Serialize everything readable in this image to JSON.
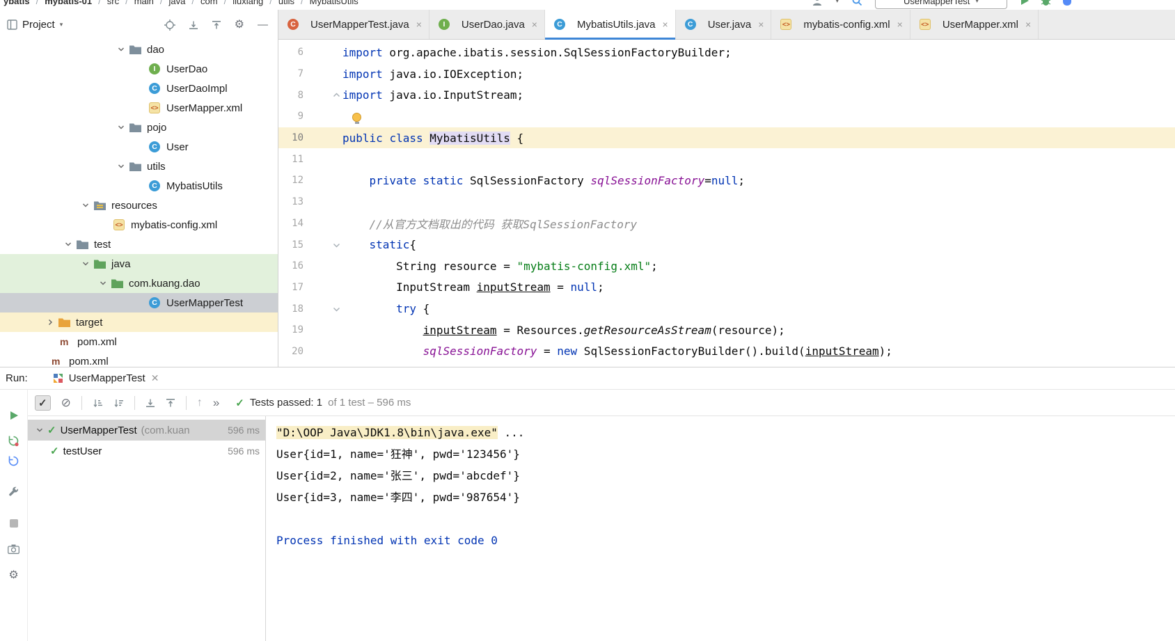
{
  "topbar": {
    "breadcrumbs": [
      "ybatis",
      "mybatis-01",
      "src",
      "main",
      "java",
      "com",
      "liuxiang",
      "utils",
      "MybatisUtils"
    ],
    "run_config": "UserMapperTest",
    "right_icons": [
      "run-icon",
      "debug-icon",
      "coverage-icon"
    ]
  },
  "project": {
    "title": "Project",
    "header_icons": [
      "locate-icon",
      "expand-all-icon",
      "collapse-all-icon",
      "settings-icon",
      "hide-icon"
    ],
    "tree": [
      {
        "label": "dao",
        "icon": "folder",
        "chevron": "down",
        "indent": 162
      },
      {
        "label": "UserDao",
        "icon": "interface",
        "indent": 214
      },
      {
        "label": "UserDaoImpl",
        "icon": "class",
        "indent": 214
      },
      {
        "label": "UserMapper.xml",
        "icon": "xml",
        "indent": 214
      },
      {
        "label": "pojo",
        "icon": "folder",
        "chevron": "down",
        "indent": 162
      },
      {
        "label": "User",
        "icon": "class",
        "indent": 214
      },
      {
        "label": "utils",
        "icon": "folder",
        "chevron": "down",
        "indent": 162
      },
      {
        "label": "MybatisUtils",
        "icon": "class",
        "indent": 214
      },
      {
        "label": "resources",
        "icon": "resources-folder",
        "chevron": "down",
        "indent": 111
      },
      {
        "label": "mybatis-config.xml",
        "icon": "xml",
        "indent": 163
      },
      {
        "label": "test",
        "icon": "folder",
        "chevron": "down",
        "indent": 86
      },
      {
        "label": "java",
        "icon": "test-folder",
        "chevron": "down",
        "indent": 111,
        "highlight": "green"
      },
      {
        "label": "com.kuang.dao",
        "icon": "test-folder",
        "chevron": "down",
        "indent": 136,
        "highlight": "green"
      },
      {
        "label": "UserMapperTest",
        "icon": "class",
        "indent": 214,
        "highlight": "sel"
      },
      {
        "label": "target",
        "icon": "excluded-folder",
        "chevron": "right",
        "indent": 60,
        "highlight": "yellow"
      },
      {
        "label": "pom.xml",
        "icon": "maven",
        "indent": 86
      },
      {
        "label": "pom.xml",
        "icon": "maven",
        "indent": 74
      }
    ]
  },
  "editor": {
    "tabs": [
      {
        "label": "UserMapperTest.java",
        "icon": "class-test"
      },
      {
        "label": "UserDao.java",
        "icon": "interface"
      },
      {
        "label": "MybatisUtils.java",
        "icon": "class",
        "active": true
      },
      {
        "label": "User.java",
        "icon": "class"
      },
      {
        "label": "mybatis-config.xml",
        "icon": "xml"
      },
      {
        "label": "UserMapper.xml",
        "icon": "xml"
      }
    ],
    "lines": [
      {
        "num": "6",
        "tokens": [
          [
            "kw",
            "import"
          ],
          [
            "pl",
            " org.apache.ibatis.session.SqlSessionFactoryBuilder;"
          ]
        ]
      },
      {
        "num": "7",
        "tokens": [
          [
            "kw",
            "import"
          ],
          [
            "pl",
            " java.io.IOException;"
          ]
        ]
      },
      {
        "num": "8",
        "fold": "up",
        "tokens": [
          [
            "kw",
            "import"
          ],
          [
            "pl",
            " java.io.InputStream;"
          ]
        ]
      },
      {
        "num": "9",
        "bulb": true,
        "tokens": []
      },
      {
        "num": "10",
        "current": true,
        "tokens": [
          [
            "kw",
            "public"
          ],
          [
            "pl",
            " "
          ],
          [
            "kw",
            "class"
          ],
          [
            "pl",
            " "
          ],
          [
            "hl",
            "MybatisUtils"
          ],
          [
            "pl",
            " {"
          ]
        ]
      },
      {
        "num": "11",
        "tokens": []
      },
      {
        "num": "12",
        "tokens": [
          [
            "pl",
            "    "
          ],
          [
            "kw",
            "private"
          ],
          [
            "pl",
            " "
          ],
          [
            "kw",
            "static"
          ],
          [
            "pl",
            " SqlSessionFactory "
          ],
          [
            "fld",
            "sqlSessionFactory"
          ],
          [
            "pl",
            "="
          ],
          [
            "kw",
            "null"
          ],
          [
            "pl",
            ";"
          ]
        ]
      },
      {
        "num": "13",
        "tokens": []
      },
      {
        "num": "14",
        "tokens": [
          [
            "pl",
            "    "
          ],
          [
            "com",
            "//从官方文档取出的代码 获取SqlSessionFactory"
          ]
        ]
      },
      {
        "num": "15",
        "fold": "down",
        "tokens": [
          [
            "pl",
            "    "
          ],
          [
            "kw",
            "static"
          ],
          [
            "pl",
            "{"
          ]
        ]
      },
      {
        "num": "16",
        "tokens": [
          [
            "pl",
            "        String resource = "
          ],
          [
            "str",
            "\"mybatis-config.xml\""
          ],
          [
            "pl",
            ";"
          ]
        ]
      },
      {
        "num": "17",
        "tokens": [
          [
            "pl",
            "        InputStream "
          ],
          [
            "ul",
            "inputStream"
          ],
          [
            "pl",
            " = "
          ],
          [
            "kw",
            "null"
          ],
          [
            "pl",
            ";"
          ]
        ]
      },
      {
        "num": "18",
        "fold": "down",
        "tokens": [
          [
            "pl",
            "        "
          ],
          [
            "kw",
            "try"
          ],
          [
            "pl",
            " {"
          ]
        ]
      },
      {
        "num": "19",
        "tokens": [
          [
            "pl",
            "            "
          ],
          [
            "ul",
            "inputStream"
          ],
          [
            "pl",
            " = Resources."
          ],
          [
            "mth",
            "getResourceAsStream"
          ],
          [
            "pl",
            "(resource);"
          ]
        ]
      },
      {
        "num": "20",
        "tokens": [
          [
            "pl",
            "            "
          ],
          [
            "fld",
            "sqlSessionFactory"
          ],
          [
            "pl",
            " = "
          ],
          [
            "kw",
            "new"
          ],
          [
            "pl",
            " SqlSessionFactoryBuilder().build("
          ],
          [
            "ul",
            "inputStream"
          ],
          [
            "pl",
            ");"
          ]
        ]
      }
    ]
  },
  "run": {
    "label": "Run:",
    "tab_label": "UserMapperTest",
    "toolbar_icons": [
      "show-passed-icon",
      "ignore-icon",
      "sep",
      "sort-alpha-icon",
      "sort-duration-icon",
      "sep",
      "expand-all-icon",
      "collapse-all-icon",
      "sep",
      "navigate-up-icon",
      "more-icon"
    ],
    "strip_icons": [
      "rerun-icon",
      "rerun-failed-icon",
      "auto-test-icon",
      "settings-wrench-icon",
      "stop-icon",
      "snapshot-icon",
      "gear-icon"
    ],
    "status_main": "Tests passed: 1",
    "status_extra": "of 1 test – 596 ms",
    "tests": [
      {
        "name": "UserMapperTest",
        "suffix": "(com.kuan",
        "time": "596 ms",
        "selected": true,
        "chevron": "down"
      },
      {
        "name": "testUser",
        "time": "596 ms",
        "indent": 30
      }
    ],
    "console": [
      {
        "highlight": "\"D:\\OOP Java\\JDK1.8\\bin\\java.exe\"",
        "text": " ..."
      },
      {
        "text": "User{id=1, name='狂神', pwd='123456'}"
      },
      {
        "text": "User{id=2, name='张三', pwd='abcdef'}"
      },
      {
        "text": "User{id=3, name='李四', pwd='987654'}"
      },
      {
        "text": ""
      },
      {
        "text": "Process finished with exit code 0",
        "style": "sys"
      }
    ]
  }
}
